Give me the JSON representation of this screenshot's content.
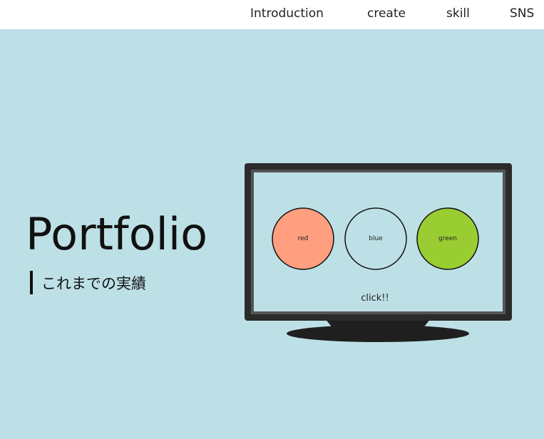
{
  "nav": {
    "items": [
      "Introduction",
      "create",
      "skill",
      "SNS"
    ]
  },
  "hero": {
    "title": "Portfolio",
    "subtitle": "これまでの実績"
  },
  "tv": {
    "buttons": [
      {
        "label": "red",
        "color": "#ff9f7f"
      },
      {
        "label": "blue",
        "color": "#bde0e6"
      },
      {
        "label": "green",
        "color": "#9acd32"
      }
    ],
    "hint": "click!!"
  },
  "colors": {
    "background": "#bde0e6",
    "nav_background": "#ffffff",
    "tv_frame": "#2b2b2b"
  }
}
